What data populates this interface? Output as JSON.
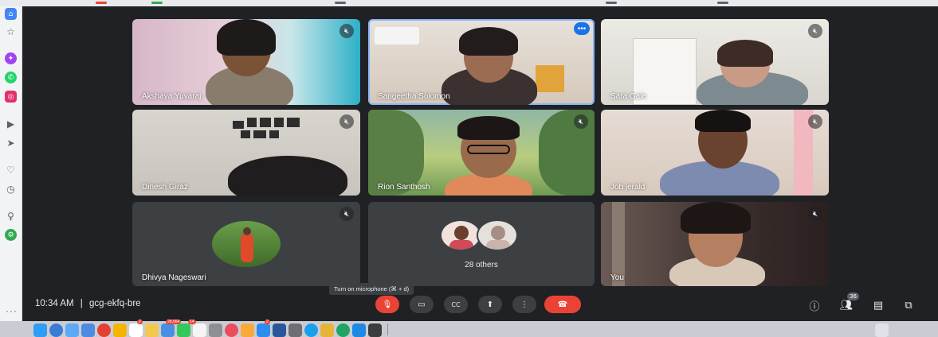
{
  "meeting": {
    "time": "10:34 AM",
    "separator": "|",
    "code": "gcg-ekfq-bre"
  },
  "tooltip": "Turn on microphone (⌘ + d)",
  "participants": [
    {
      "name": "Akshaya Yuvaraj"
    },
    {
      "name": "Sangeetha Solomon"
    },
    {
      "name": "Sara Gale"
    },
    {
      "name": "Dinesh Giraz"
    },
    {
      "name": "Rion Santhosh"
    },
    {
      "name": "Job jerald"
    },
    {
      "name": "Dhivya Nageswari"
    },
    {
      "name": "You"
    }
  ],
  "others": {
    "label": "28 others"
  },
  "people_count": "36",
  "icons": {
    "muted": "mic-off-icon",
    "more": "more-options-icon",
    "camera": "camera-icon",
    "captions": "captions-icon",
    "present": "present-screen-icon",
    "options": "more-vert-icon",
    "hangup": "end-call-icon",
    "info": "info-icon",
    "people": "people-icon",
    "chat": "chat-icon",
    "activities": "activities-icon"
  },
  "colors": {
    "background": "#202124",
    "tile": "#3c4043",
    "active_border": "#8ab4f8",
    "danger": "#ea4335",
    "accent": "#1a73e8"
  },
  "dock": {
    "badges": [
      "2",
      "28,564",
      "14",
      "2"
    ]
  }
}
